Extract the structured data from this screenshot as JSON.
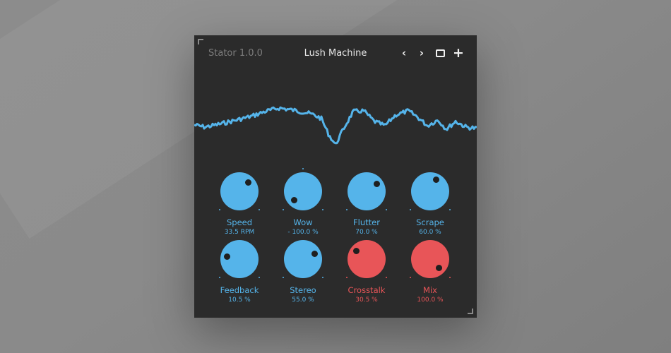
{
  "header": {
    "version": "Stator 1.0.0",
    "preset": "Lush Machine",
    "icons": [
      "chevron-left-icon",
      "chevron-right-icon",
      "window-icon",
      "plus-icon"
    ]
  },
  "colors": {
    "blue": "#55b4ea",
    "red": "#e85558",
    "panel": "#2b2b2b"
  },
  "knobs": [
    {
      "label": "Speed",
      "value": "33.5 RPM",
      "position": 0.67,
      "color": "blue"
    },
    {
      "label": "Wow",
      "value": "- 100.0 %",
      "position": 0.0,
      "color": "blue"
    },
    {
      "label": "Flutter",
      "value": "70.0 %",
      "position": 0.7,
      "color": "blue"
    },
    {
      "label": "Scrape",
      "value": "60.0 %",
      "position": 0.6,
      "color": "blue"
    },
    {
      "label": "Feedback",
      "value": "10.5 %",
      "position": 0.21,
      "color": "blue"
    },
    {
      "label": "Stereo",
      "value": "55.0 %",
      "position": 0.74,
      "color": "blue"
    },
    {
      "label": "Crosstalk",
      "value": "30.5 %",
      "position": 0.31,
      "color": "red"
    },
    {
      "label": "Mix",
      "value": "100.0 %",
      "position": 1.0,
      "color": "red"
    }
  ]
}
